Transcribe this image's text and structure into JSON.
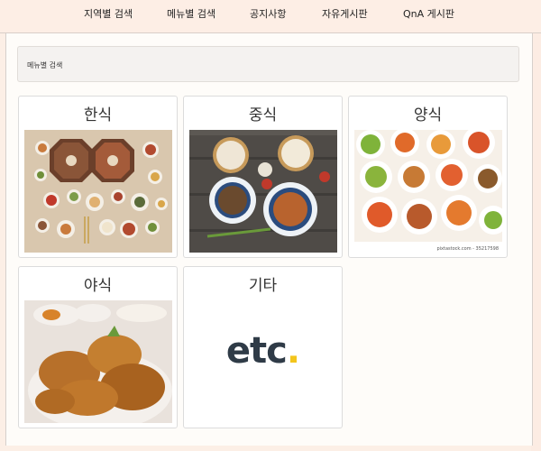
{
  "nav": {
    "items": [
      "지역별 검색",
      "메뉴별 검색",
      "공지사항",
      "자유게시판",
      "QnA 게시판"
    ]
  },
  "breadcrumb": {
    "label": "메뉴별 검색"
  },
  "categories": [
    {
      "title": "한식",
      "image": "korean-table-spread"
    },
    {
      "title": "중식",
      "image": "chinese-dumplings-noodles"
    },
    {
      "title": "양식",
      "image": "western-pasta-plates",
      "watermark": "pixtastock.com - 35217598"
    },
    {
      "title": "야식",
      "image": "fried-chicken"
    },
    {
      "title": "기타",
      "image": "etc-logo",
      "logo_text": "etc",
      "logo_dot": "."
    }
  ],
  "colors": {
    "nav_bg": "#fdeee5",
    "page_bg": "#fefcf9",
    "etc_text": "#2f3b47",
    "etc_dot": "#f3c51c"
  }
}
